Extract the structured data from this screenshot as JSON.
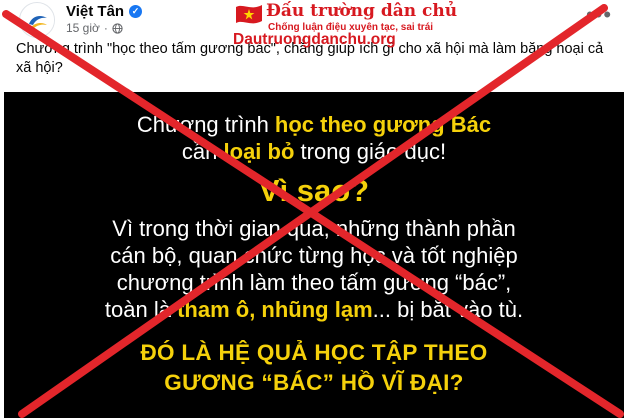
{
  "post": {
    "author": "Việt Tân",
    "time": "15 giờ",
    "privacy_dot": "·",
    "more_label": "•••",
    "verified_glyph": "✓",
    "caption": "Chương trình \"học theo tấm gương bác\", chẳng giúp ích gì cho xã hội mà làm băng hoại cả xã hội?"
  },
  "watermark": {
    "name": "Đấu trường dân chủ",
    "tagline": "Chống luận điệu xuyên tạc, sai trái",
    "url": "Dautruongdanchu.org"
  },
  "image_text": {
    "l1_a": "Chương trình ",
    "l1_b": "học theo gương Bác",
    "l2_a": "cần ",
    "l2_b": "loại bỏ",
    "l2_c": " trong giáo dục!",
    "l3": "Vì sao?",
    "l4": "Vì trong thời gian qua, những thành phần",
    "l5": "cán bộ, quan chức từng học và tốt nghiệp",
    "l6": "chương trình làm theo tấm gương “bác”,",
    "l7_a": "toàn là ",
    "l7_b": "tham ô, nhũng lạm",
    "l7_c": "... bị bắt vào tù.",
    "l8": "ĐÓ LÀ HỆ QUẢ HỌC TẬP THEO",
    "l9": "GƯƠNG “BÁC” HỒ VĨ ĐẠI?"
  },
  "colors": {
    "cross": "#e3262b",
    "highlight": "#f5d10b",
    "brand": "#d71920",
    "panel": "#000000"
  }
}
